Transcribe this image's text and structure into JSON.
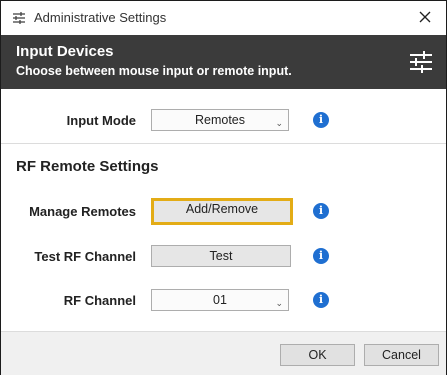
{
  "window": {
    "title": "Administrative Settings",
    "app_icon": "sliders-icon",
    "close_icon": "close-icon"
  },
  "header": {
    "title": "Input Devices",
    "subtitle": "Choose between mouse input or remote input.",
    "icon": "sliders-icon",
    "background": "#3b3b3b"
  },
  "input_mode": {
    "label": "Input Mode",
    "value": "Remotes"
  },
  "rf_section": {
    "title": "RF Remote Settings"
  },
  "manage_remotes": {
    "label": "Manage Remotes",
    "button": "Add/Remove",
    "focus_color": "#e3ac16"
  },
  "test_rf": {
    "label": "Test RF Channel",
    "button": "Test"
  },
  "rf_channel": {
    "label": "RF Channel",
    "value": "01"
  },
  "info_icon": {
    "glyph": "i",
    "color": "#1f6fd1"
  },
  "footer": {
    "ok": "OK",
    "cancel": "Cancel"
  }
}
